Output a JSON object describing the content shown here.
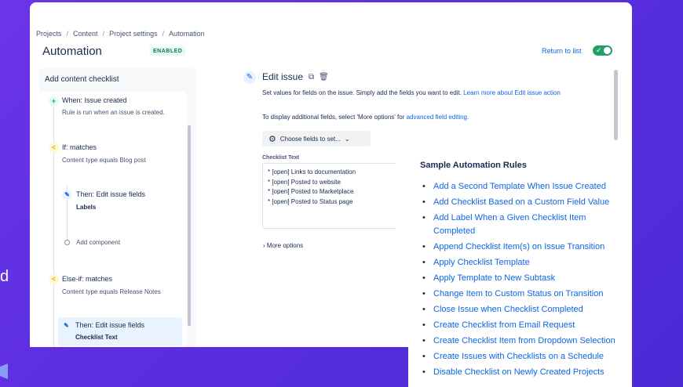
{
  "background": {
    "fragment_text": "d"
  },
  "breadcrumb": [
    "Projects",
    "Content",
    "Project settings",
    "Automation"
  ],
  "header": {
    "title": "Automation",
    "status_badge": "ENABLED",
    "return_link": "Return to list",
    "toggle_on": true
  },
  "sidebar": {
    "title": "Add content checklist",
    "nodes": [
      {
        "kind": "when",
        "icon": "plus-icon",
        "title": "When: Issue created",
        "subtitle": "Rule is run when an issue is created."
      },
      {
        "kind": "if",
        "icon": "branch-icon",
        "title": "If: matches",
        "subtitle": "Content type equals Blog post"
      },
      {
        "kind": "action",
        "icon": "pencil-icon",
        "title": "Then: Edit issue fields",
        "subtitle": "Labels"
      },
      {
        "kind": "add",
        "icon": "add-dot-icon",
        "title": "Add component"
      },
      {
        "kind": "elseif",
        "icon": "branch-icon",
        "title": "Else-if: matches",
        "subtitle": "Content type equals Release Notes"
      },
      {
        "kind": "action-selected",
        "icon": "pencil-icon",
        "title": "Then: Edit issue fields",
        "subtitle": "Checklist Text"
      }
    ]
  },
  "editor": {
    "title": "Edit issue",
    "description": "Set values for fields on the issue. Simply add the fields you want to edit.",
    "learn_more": "Learn more about Edit issue action",
    "display_note": "To display additional fields, select 'More options' for",
    "advanced_link": "advanced field editing.",
    "choose_fields": "Choose fields to set...",
    "field_label": "Checklist Text",
    "checklist_lines": [
      "* [open] Links to documentation",
      "* [open] Posted to website",
      "* [open] Posted to Marketplace",
      "* [open] Posted to Status page"
    ],
    "more_options": "More options"
  },
  "overlay": {
    "title": "Sample Automation Rules",
    "rules": [
      "Add a Second Template When Issue Created",
      "Add Checklist Based on a Custom Field Value",
      "Add Label When a Given Checklist Item Completed",
      "Append Checklist Item(s) on Issue Transition",
      "Apply Checklist Template",
      "Apply Template to New Subtask",
      "Change Item to Custom Status on Transition",
      "Close Issue when Checklist Completed",
      "Create Checklist from Email Request",
      "Create Checklist Item from Dropdown Selection",
      "Create Issues with Checklists on a Schedule",
      "Disable Checklist on Newly Created Projects"
    ]
  },
  "colors": {
    "accent": "#0c66e4",
    "background": "#5a2ee0",
    "success": "#22a06b"
  }
}
